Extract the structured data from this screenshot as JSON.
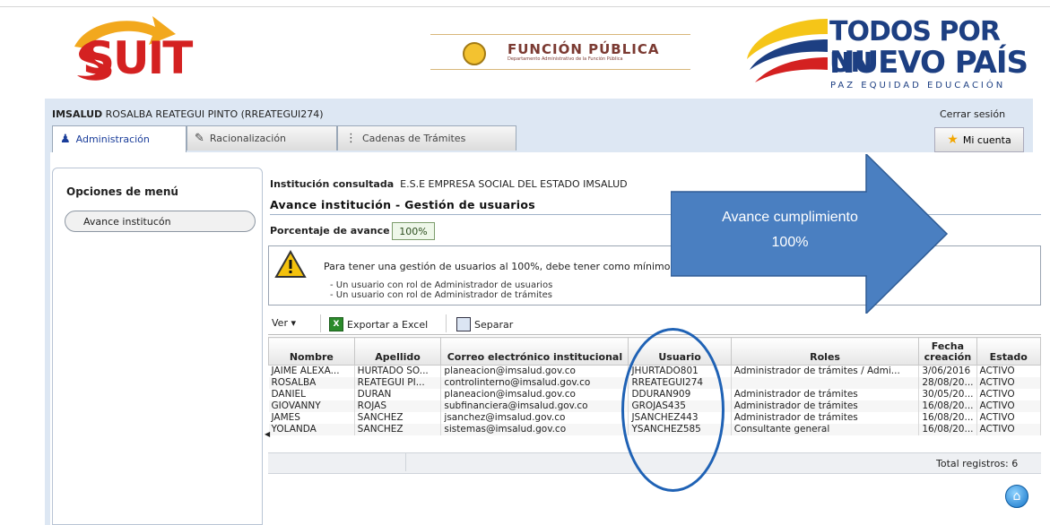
{
  "header": {
    "suit_logo": "SUIT",
    "funcion_publica_title": "FUNCIÓN PÚBLICA",
    "funcion_publica_sub": "Departamento Administrativo de la Función Pública",
    "tpn_line1": "TODOS POR UN",
    "tpn_line2": "NUEVO PAÍS",
    "tpn_line3": "PAZ  EQUIDAD  EDUCACIÓN"
  },
  "user": {
    "org": "IMSALUD",
    "name": "ROSALBA REATEGUI PINTO (RREATEGUI274)",
    "logout": "Cerrar sesión"
  },
  "tabs": [
    {
      "label": "Administración",
      "icon": "users-icon"
    },
    {
      "label": "Racionalización",
      "icon": "edit-icon"
    },
    {
      "label": "Cadenas de Trámites",
      "icon": "chain-icon"
    }
  ],
  "my_account": "Mi cuenta",
  "sidebar": {
    "title": "Opciones de menú",
    "items": [
      {
        "label": "Avance institucón"
      }
    ]
  },
  "main": {
    "inst_label": "Institución consultada",
    "inst_value": "E.S.E EMPRESA SOCIAL DEL ESTADO IMSALUD",
    "heading": "Avance institución - Gestión de usuarios",
    "pct_label": "Porcentaje de avance",
    "pct_value": "100%",
    "notice_line1": "Para tener una gestión de usuarios al 100%, debe tener como mínimo:",
    "notice_line2": "- Un usuario con rol de Administrador de usuarios",
    "notice_line3": "- Un usuario con rol de Administrador de trámites"
  },
  "toolbar": {
    "view": "Ver ▾",
    "export": "Exportar a Excel",
    "split": "Separar"
  },
  "table": {
    "headers": [
      "Nombre",
      "Apellido",
      "Correo electrónico institucional",
      "Usuario",
      "Roles",
      "Fecha creación",
      "Estado"
    ],
    "rows": [
      [
        "JAIME ALEXA...",
        "HURTADO SO...",
        "planeacion@imsalud.gov.co",
        "JHURTADO801",
        "Administrador de trámites / Admi...",
        "3/06/2016",
        "ACTIVO"
      ],
      [
        "ROSALBA",
        "REATEGUI PI...",
        "controlinterno@imsalud.gov.co",
        "RREATEGUI274",
        "",
        "28/08/20...",
        "ACTIVO"
      ],
      [
        "DANIEL",
        "DURAN",
        "planeacion@imsalud.gov.co",
        "DDURAN909",
        "Administrador de trámites",
        "30/05/20...",
        "ACTIVO"
      ],
      [
        "GIOVANNY",
        "ROJAS",
        "subfinanciera@imsalud.gov.co",
        "GROJAS435",
        "Administrador de trámites",
        "16/08/20...",
        "ACTIVO"
      ],
      [
        "JAMES",
        "SANCHEZ",
        "jsanchez@imsalud.gov.co",
        "JSANCHEZ443",
        "Administrador de trámites",
        "16/08/20...",
        "ACTIVO"
      ],
      [
        "YOLANDA",
        "SANCHEZ",
        "sistemas@imsalud.gov.co",
        "YSANCHEZ585",
        "Consultante general",
        "16/08/20...",
        "ACTIVO"
      ]
    ],
    "total": "Total registros: 6"
  },
  "annotation": {
    "line1": "Avance cumplimiento",
    "line2": "100%",
    "color": "#4a7fc1"
  }
}
